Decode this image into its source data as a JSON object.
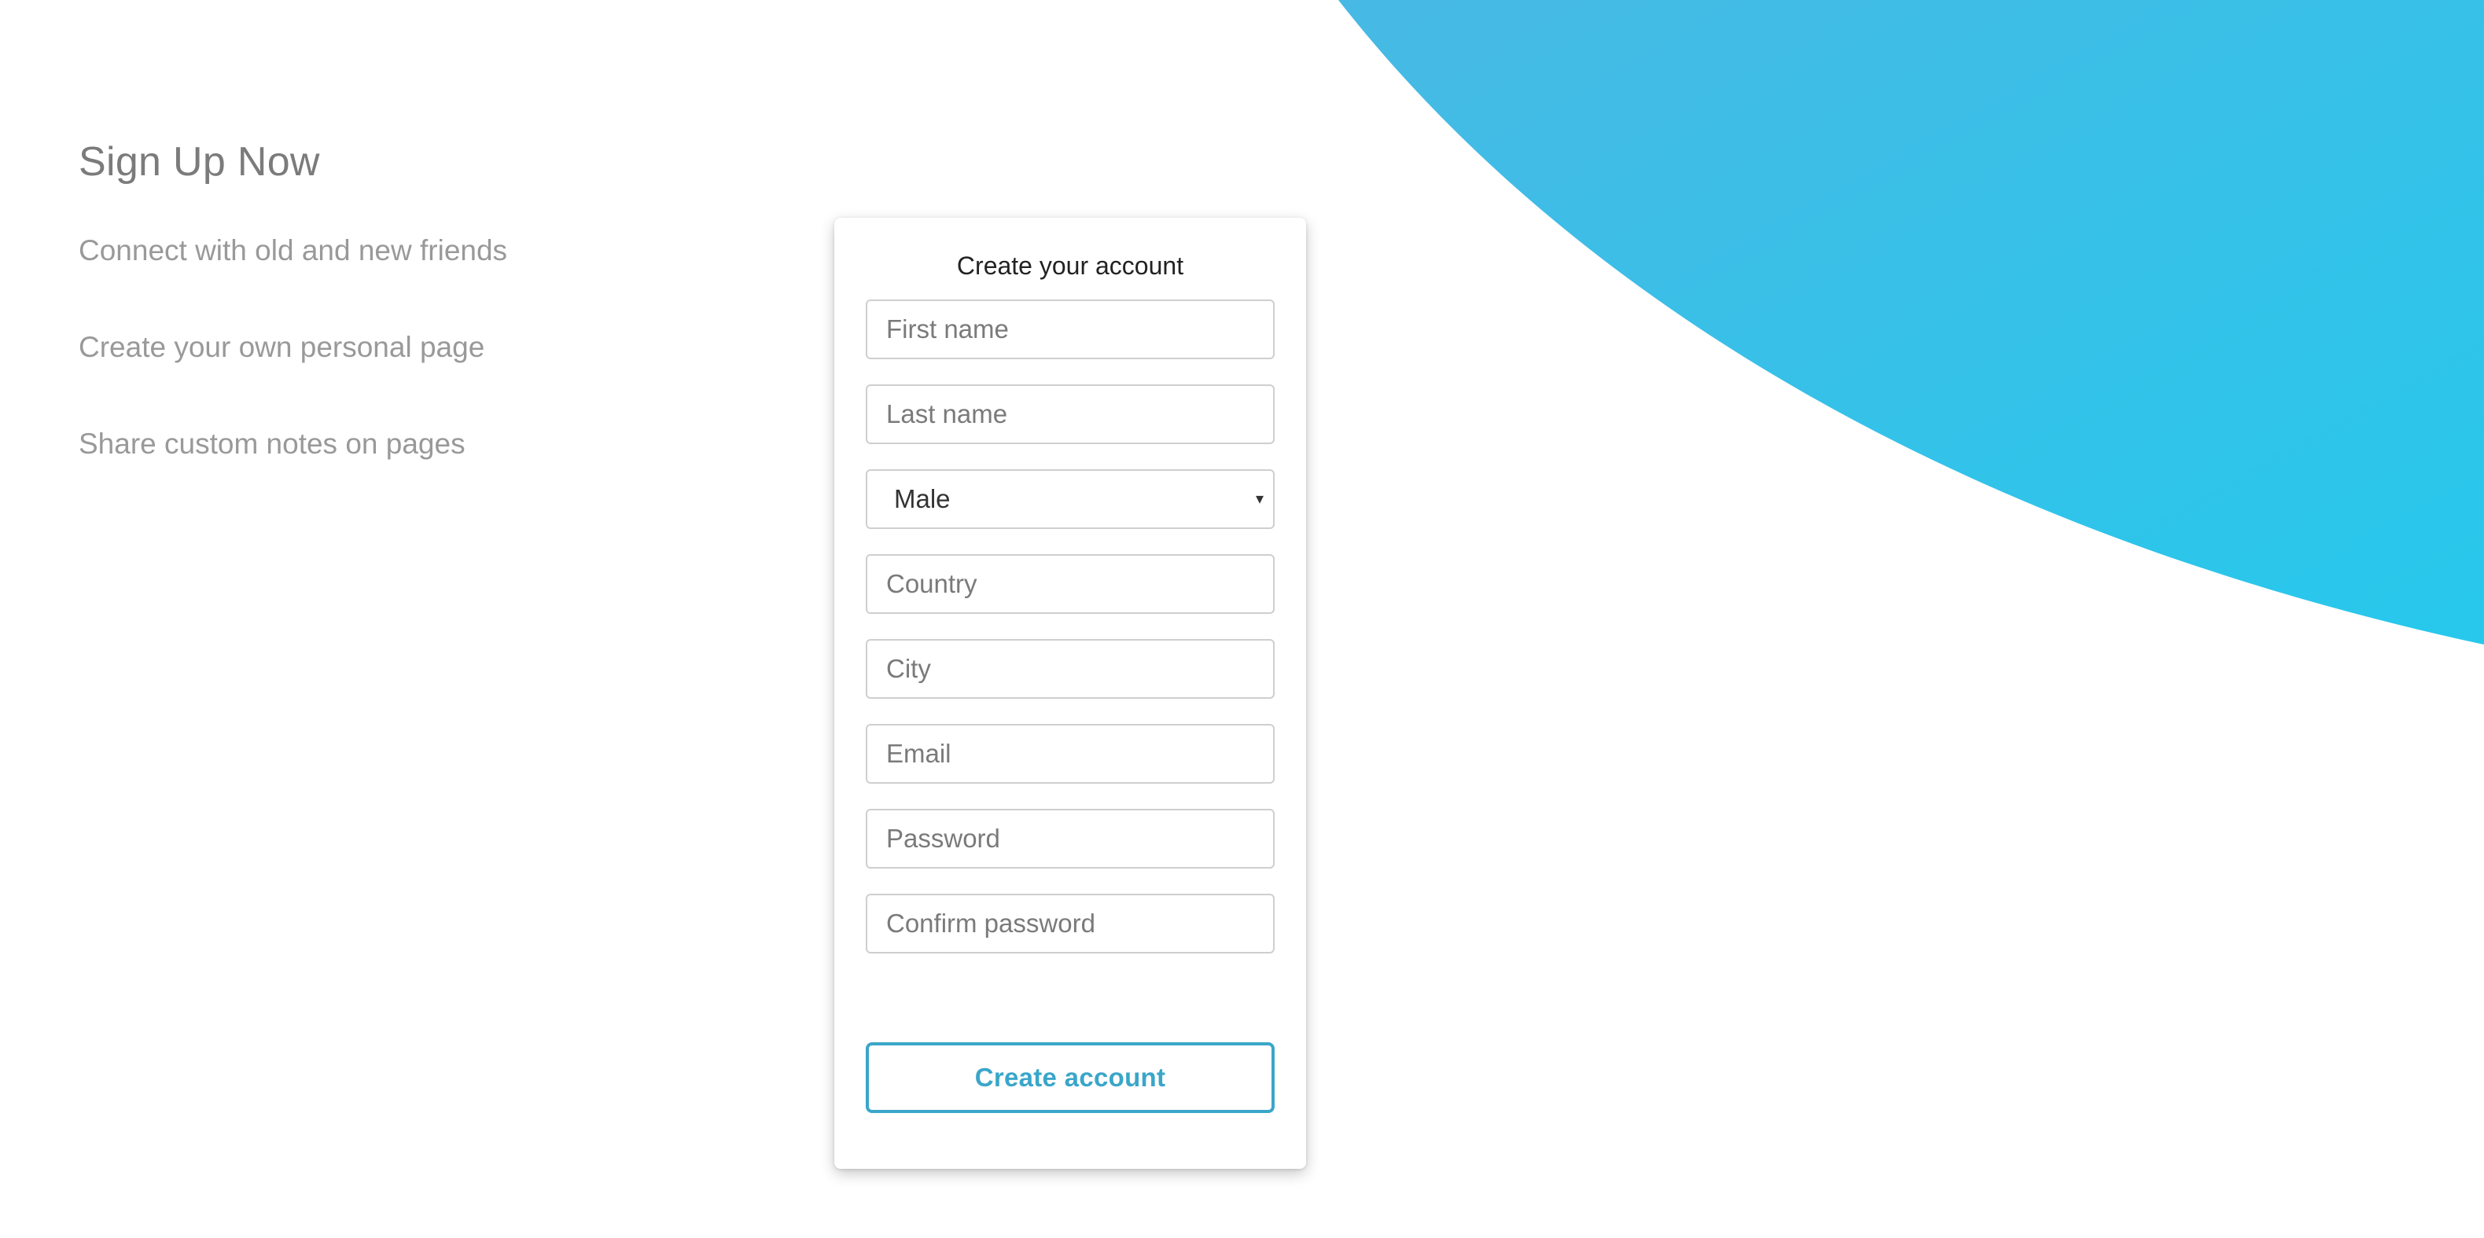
{
  "colors": {
    "accent": "#3aa6c9",
    "blob": "#33c3e8"
  },
  "intro": {
    "title": "Sign Up Now",
    "features": [
      "Connect with old and new friends",
      "Create your own personal page",
      "Share custom notes on pages"
    ]
  },
  "form": {
    "title": "Create your account",
    "first_name_placeholder": "First name",
    "last_name_placeholder": "Last name",
    "gender_value": "Male",
    "gender_caret_icon": "caret-down-icon",
    "country_placeholder": "Country",
    "city_placeholder": "City",
    "email_placeholder": "Email",
    "password_placeholder": "Password",
    "confirm_password_placeholder": "Confirm password",
    "submit_label": "Create account"
  }
}
